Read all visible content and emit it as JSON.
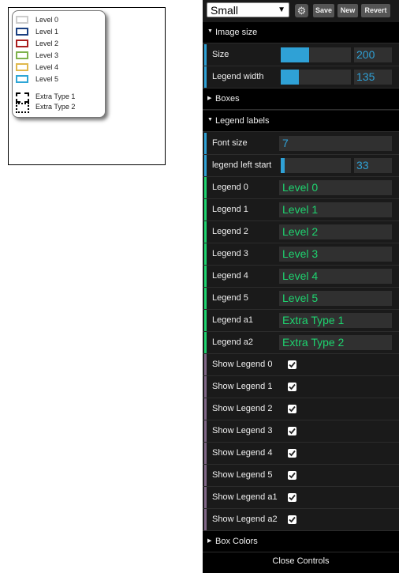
{
  "preview": {
    "legend": [
      {
        "label": "Level 0",
        "color": "#cccccc"
      },
      {
        "label": "Level 1",
        "color": "#1a3f80"
      },
      {
        "label": "Level 2",
        "color": "#aa1d1d"
      },
      {
        "label": "Level 3",
        "color": "#7fb24d"
      },
      {
        "label": "Level 4",
        "color": "#e0b84c"
      },
      {
        "label": "Level 5",
        "color": "#2ea6d6"
      }
    ],
    "extras": [
      {
        "label": "Extra Type 1",
        "style": "dashed"
      },
      {
        "label": "Extra Type 2",
        "style": "dotted"
      }
    ]
  },
  "toolbar": {
    "preset_value": "Small",
    "gear_icon": "gear-icon",
    "save_label": "Save",
    "new_label": "New",
    "revert_label": "Revert"
  },
  "folders": {
    "image_size": "Image size",
    "boxes": "Boxes",
    "legend_labels": "Legend labels",
    "box_colors": "Box Colors"
  },
  "controls": {
    "size": {
      "label": "Size",
      "value": "200",
      "fraction": 0.4
    },
    "legend_width": {
      "label": "Legend width",
      "value": "135",
      "fraction": 0.26
    },
    "font_size": {
      "label": "Font size",
      "value": "7"
    },
    "legend_left_start": {
      "label": "legend left start",
      "value": "33",
      "fraction": 0.06
    },
    "legends": [
      {
        "label": "Legend 0",
        "value": "Level 0"
      },
      {
        "label": "Legend 1",
        "value": "Level 1"
      },
      {
        "label": "Legend 2",
        "value": "Level 2"
      },
      {
        "label": "Legend 3",
        "value": "Level 3"
      },
      {
        "label": "Legend 4",
        "value": "Level 4"
      },
      {
        "label": "Legend 5",
        "value": "Level 5"
      },
      {
        "label": "Legend a1",
        "value": "Extra Type 1"
      },
      {
        "label": "Legend a2",
        "value": "Extra Type 2"
      }
    ],
    "shows": [
      {
        "label": "Show Legend 0",
        "checked": true
      },
      {
        "label": "Show Legend 1",
        "checked": true
      },
      {
        "label": "Show Legend 2",
        "checked": true
      },
      {
        "label": "Show Legend 3",
        "checked": true
      },
      {
        "label": "Show Legend 4",
        "checked": true
      },
      {
        "label": "Show Legend 5",
        "checked": true
      },
      {
        "label": "Show Legend a1",
        "checked": true
      },
      {
        "label": "Show Legend a2",
        "checked": true
      }
    ]
  },
  "close_controls": "Close Controls",
  "colors": {
    "number": "#2fa1d6",
    "string": "#1ed36f",
    "boolean": "#806787",
    "panel_bg": "#1a1a1a"
  }
}
